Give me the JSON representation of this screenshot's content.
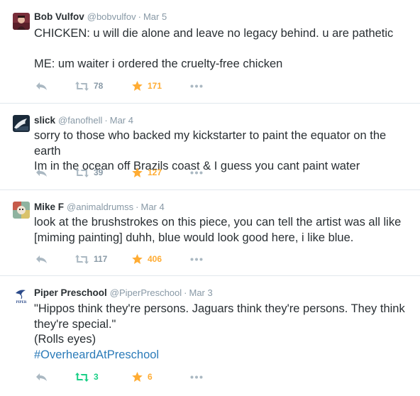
{
  "colors": {
    "text": "#292f33",
    "muted": "#8899a6",
    "link": "#2b7bb9",
    "favorite": "#ffac33",
    "retweet_active": "#19cf86",
    "divider": "#e1e8ed"
  },
  "tweets": [
    {
      "fullname": "Bob Vulfov",
      "username": "@bobvulfov",
      "time": "Mar 5",
      "avatar": "bob-vulfov-avatar",
      "lines": [
        "CHICKEN: u will die alone and leave no legacy behind. u are pathetic",
        "",
        "ME: um waiter i ordered the cruelty-free chicken"
      ],
      "retweets": "78",
      "favorites": "171",
      "retweeted": false
    },
    {
      "fullname": "slick",
      "username": "@fanofhell",
      "time": "Mar 4",
      "avatar": "slick-avatar",
      "lines": [
        "sorry to those who backed my kickstarter to paint the equator on the earth",
        "Im in the ocean off Brazils coast & I guess you cant paint water"
      ],
      "retweets": "39",
      "favorites": "127",
      "retweeted": false
    },
    {
      "fullname": "Mike F",
      "username": "@animaldrumss",
      "time": "Mar 4",
      "avatar": "mike-f-avatar",
      "lines": [
        "look at the brushstrokes on this piece, you can tell the artist was all like",
        "[miming painting] duhh, blue would look good here, i like blue."
      ],
      "retweets": "117",
      "favorites": "406",
      "retweeted": false
    },
    {
      "fullname": "Piper Preschool",
      "username": "@PiperPreschool",
      "time": "Mar 3",
      "avatar": "piper-preschool-logo",
      "avatar_text": "PIPER",
      "lines": [
        "\"Hippos think they're persons. Jaguars think they're persons. They think",
        "they're special.\"",
        "(Rolls eyes)"
      ],
      "hashtag": "#OverheardAtPreschool",
      "retweets": "3",
      "favorites": "6",
      "retweeted": true
    }
  ],
  "icons": {
    "reply": "reply-icon",
    "retweet": "retweet-icon",
    "favorite": "star-icon",
    "more": "more-dots-icon"
  },
  "dot": "·"
}
